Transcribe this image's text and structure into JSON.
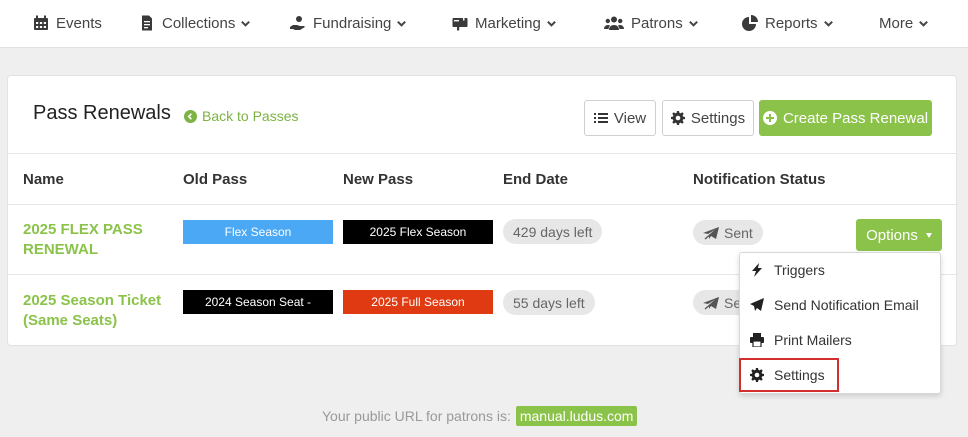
{
  "nav": {
    "events": "Events",
    "collections": "Collections",
    "fundraising": "Fundraising",
    "marketing": "Marketing",
    "patrons": "Patrons",
    "reports": "Reports",
    "more": "More"
  },
  "page": {
    "title": "Pass Renewals",
    "back_label": "Back to Passes",
    "view_label": "View",
    "settings_label": "Settings",
    "create_label": "Create Pass Renewal"
  },
  "table": {
    "headers": [
      "Name",
      "Old Pass",
      "New Pass",
      "End Date",
      "Notification Status"
    ],
    "rows": [
      {
        "name_line1": "2025 FLEX PASS",
        "name_line2": "RENEWAL",
        "old_pass": "Flex Season",
        "old_pass_color": "#4aa8f5",
        "new_pass": "2025 Flex Season",
        "new_pass_color": "#000000",
        "end_date": "429 days left",
        "status": "Sent"
      },
      {
        "name_line1": "2025 Season Ticket",
        "name_line2": "(Same Seats)",
        "old_pass": "2024 Season Seat -",
        "old_pass_color": "#000000",
        "new_pass": "2025 Full Season",
        "new_pass_color": "#e03a12",
        "end_date": "55 days left",
        "status": "Se"
      }
    ]
  },
  "options": {
    "label": "Options",
    "menu": [
      "Triggers",
      "Send Notification Email",
      "Print Mailers",
      "Settings"
    ]
  },
  "footer": {
    "text": "Your public URL for patrons is:",
    "url": "manual.ludus.com"
  },
  "colors": {
    "accent": "#8bc34a",
    "highlight": "#d32f2f"
  }
}
